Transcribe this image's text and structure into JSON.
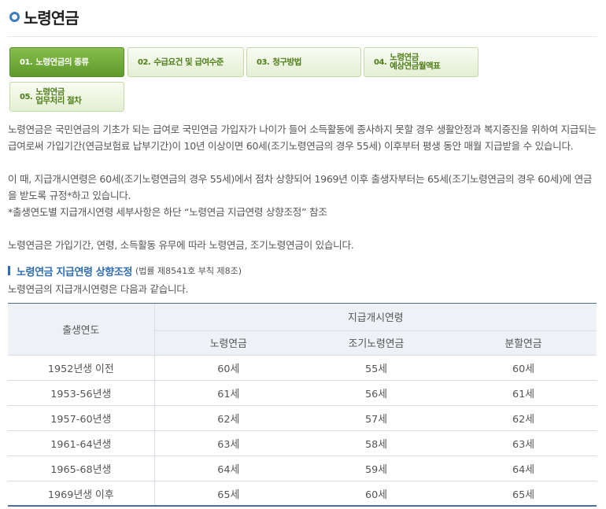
{
  "page": {
    "title": "노령연금"
  },
  "tabs": [
    {
      "num": "01.",
      "label": "노령연금의 종류",
      "active": true
    },
    {
      "num": "02.",
      "label": "수급요건 및 급여수준",
      "active": false
    },
    {
      "num": "03.",
      "label": "청구방법",
      "active": false
    },
    {
      "num": "04.",
      "label_line1": "노령연금",
      "label_line2": "예상연금월액표",
      "active": false
    },
    {
      "num": "05.",
      "label_line1": "노령연금",
      "label_line2": "업무처리 절차",
      "active": false
    }
  ],
  "content": {
    "para1": "노령연금은 국민연금의 기초가 되는 급여로 국민연금 가입자가 나이가 들어 소득활동에 종사하지 못할 경우 생활안정과 복지증진을 위하여 지급되는 급여로써 가입기간(연금보험료 납부기간)이 10년 이상이면 60세(조기노령연금의 경우 55세) 이후부터 평생 동안 매월 지급받을 수 있습니다.",
    "para2": "이 때, 지급개시연령은 60세(조기노령연금의 경우 55세)에서 점차 상향되어 1969년 이후 출생자부터는 65세(조기노령연금의 경우 60세)에 연금을 받도록 규정*하고 있습니다.",
    "para3": "*출생연도별 지급개시연령 세부사항은 하단 “노령연금 지급연령 상향조정” 참조",
    "para4": "노령연금은 가입기간, 연령, 소득활동 유무에 따라 노령연금, 조기노령연금이 있습니다.",
    "subhead_title": "노령연금 지급연령 상향조정",
    "subhead_note": "(법률 제8541호 부칙 제8조)",
    "para5": "노령연금의 지급개시연령은 다음과 같습니다."
  },
  "table": {
    "header_birth": "출생연도",
    "header_group": "지급개시연령",
    "col_headers": [
      "노령연금",
      "조기노령연금",
      "분할연금"
    ],
    "rows": [
      [
        "1952년생 이전",
        "60세",
        "55세",
        "60세"
      ],
      [
        "1953-56년생",
        "61세",
        "56세",
        "61세"
      ],
      [
        "1957-60년생",
        "62세",
        "57세",
        "62세"
      ],
      [
        "1961-64년생",
        "63세",
        "58세",
        "63세"
      ],
      [
        "1965-68년생",
        "64세",
        "59세",
        "64세"
      ],
      [
        "1969년생 이후",
        "65세",
        "60세",
        "65세"
      ]
    ]
  }
}
